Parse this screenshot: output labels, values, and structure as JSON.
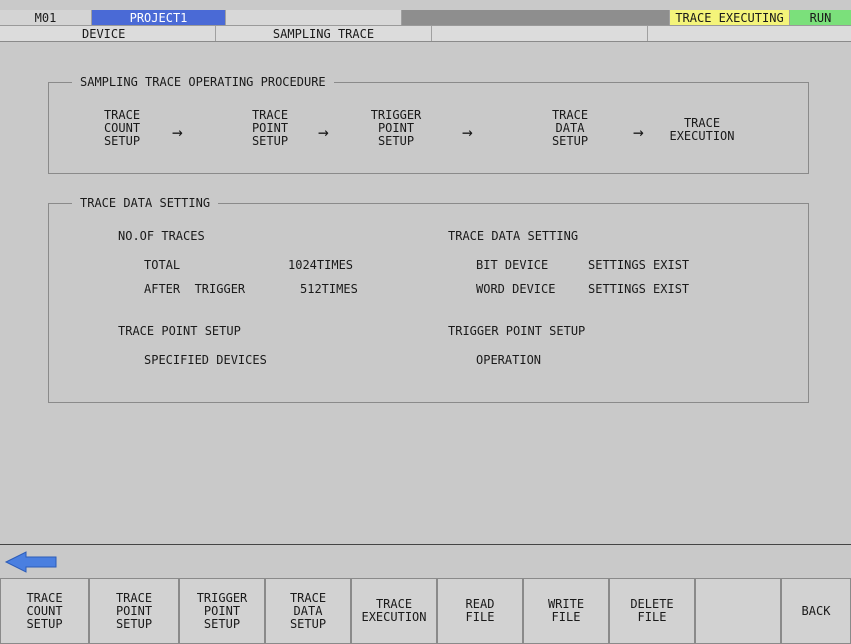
{
  "status_bar": {
    "station": "M01",
    "project": "PROJECT1",
    "trace_status": "TRACE EXECUTING",
    "run_status": "RUN",
    "colors": {
      "project_bg": "#4a6ad6",
      "trace_bg": "#f4f47a",
      "run_bg": "#7be07b"
    }
  },
  "nav": {
    "device": "DEVICE",
    "sampling_trace": "SAMPLING TRACE"
  },
  "procedure": {
    "title": "SAMPLING TRACE OPERATING PROCEDURE",
    "steps": [
      "TRACE\nCOUNT\nSETUP",
      "TRACE\nPOINT\nSETUP",
      "TRIGGER\nPOINT\nSETUP",
      "TRACE\nDATA\nSETUP",
      "TRACE\nEXECUTION"
    ],
    "arrow": "→"
  },
  "trace_data": {
    "title": "TRACE DATA SETTING",
    "no_of_traces_label": "NO.OF TRACES",
    "total_label": "TOTAL",
    "total_value": "1024TIMES",
    "after_trigger_label": "AFTER  TRIGGER",
    "after_trigger_value": "512TIMES",
    "trace_point_setup_label": "TRACE POINT SETUP",
    "trace_point_setup_value": "SPECIFIED DEVICES",
    "trace_data_setting_label": "TRACE DATA SETTING",
    "bit_device_label": "BIT DEVICE",
    "bit_device_value": "SETTINGS EXIST",
    "word_device_label": "WORD DEVICE",
    "word_device_value": "SETTINGS EXIST",
    "trigger_point_setup_label": "TRIGGER POINT SETUP",
    "trigger_point_setup_value": "OPERATION"
  },
  "back_arrow_icon": "left-arrow-icon",
  "function_keys": [
    "TRACE\nCOUNT\nSETUP",
    "TRACE\nPOINT\nSETUP",
    "TRIGGER\nPOINT\nSETUP",
    "TRACE\nDATA\nSETUP",
    "TRACE\nEXECUTION",
    "READ\nFILE",
    "WRITE\nFILE",
    "DELETE\nFILE",
    "",
    "BACK"
  ]
}
